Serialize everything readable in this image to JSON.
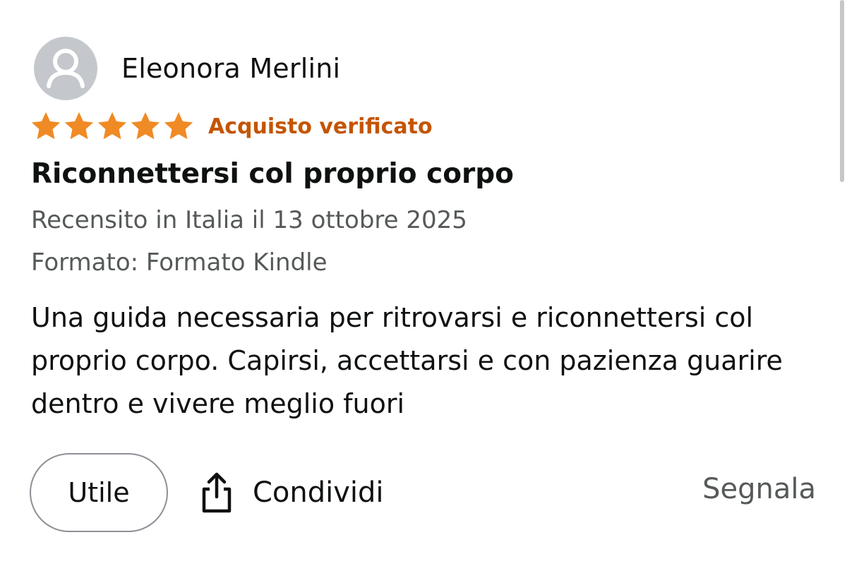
{
  "reviewer": {
    "name": "Eleonora Merlini",
    "avatar_icon": "user-silhouette-icon"
  },
  "rating": {
    "stars": 5,
    "max": 5,
    "star_color": "#f08a24",
    "verified_label": "Acquisto verificato",
    "verified_color": "#c45500"
  },
  "review": {
    "title": "Riconnettersi col proprio corpo",
    "date": "Recensito in Italia il 13 ottobre 2025",
    "format": "Formato: Formato Kindle",
    "body": "Una guida necessaria per ritrovarsi e riconnettersi col proprio corpo. Capirsi, accettarsi e con pazienza guarire dentro e vivere meglio fuori"
  },
  "actions": {
    "helpful_label": "Utile",
    "share_label": "Condividi",
    "share_icon": "share-icon",
    "report_label": "Segnala"
  }
}
